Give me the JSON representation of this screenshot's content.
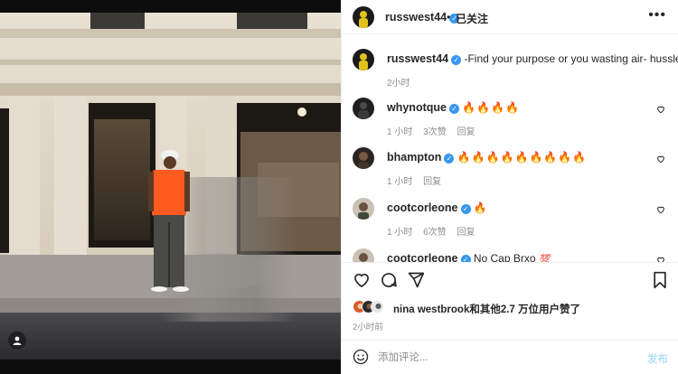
{
  "header": {
    "username": "russwest44",
    "separator": "•",
    "follow_label": "已关注",
    "more_label": "•••"
  },
  "caption": {
    "username": "russwest44",
    "text": "-Find your purpose or you wasting air- hussle.",
    "time": "2小时"
  },
  "comments": [
    {
      "username": "whynotque",
      "text": "🔥🔥🔥🔥",
      "time": "1 小时",
      "likes": "3次赞",
      "reply": "回复"
    },
    {
      "username": "bhampton",
      "text": "🔥🔥🔥🔥🔥🔥🔥🔥🔥",
      "time": "1 小时",
      "likes": "",
      "reply": "回复"
    },
    {
      "username": "cootcorleone",
      "text": "🔥",
      "time": "1 小时",
      "likes": "6次赞",
      "reply": "回复"
    },
    {
      "username": "cootcorleone",
      "text": "No Cap Brxo",
      "badge": "💯",
      "time": "",
      "likes": "",
      "reply": ""
    }
  ],
  "likes_text": "nina westbrook和其他2.7 万位用户赞了",
  "post_time": "2小时前",
  "add_comment": {
    "placeholder": "添加评论...",
    "post_label": "发布"
  },
  "colors": {
    "verified": "#3897f0",
    "vest": "#ff5a1f",
    "post_button": "#b2dffc",
    "meta_text": "#8e8e8e"
  },
  "icons": [
    "heart-icon",
    "comment-icon",
    "share-icon",
    "bookmark-icon",
    "emoji-icon",
    "tag-person-icon",
    "verified-icon"
  ]
}
